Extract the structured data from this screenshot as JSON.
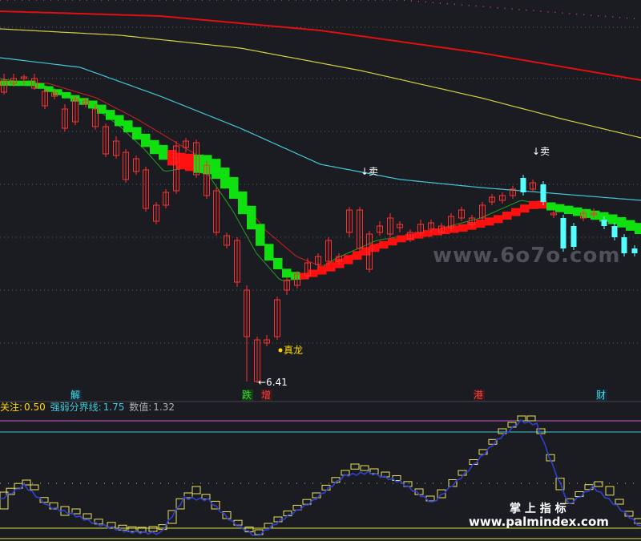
{
  "chart_data": {
    "type": "candlestick",
    "price_chart": {
      "price_marker_low": "←6.41",
      "buy_marker": "真龙",
      "sell_markers": [
        "↓卖",
        "↓卖"
      ],
      "date_tags": [
        {
          "text": "解",
          "color": "#40e0e0"
        },
        {
          "text": "跌",
          "color": "#30e030"
        },
        {
          "text": "增",
          "color": "#ff4040"
        },
        {
          "text": "港",
          "color": "#ff4040"
        },
        {
          "text": "财",
          "color": "#40e0e0"
        }
      ],
      "watermark": "www.6o7o.com"
    },
    "indicator": {
      "label_focus": "关注:",
      "value_focus": "0.50",
      "label_threshold": "强弱分界线:",
      "value_threshold": "1.75",
      "label_value": "数值:",
      "value_value": "1.32",
      "watermark_title": "掌 上 指 标",
      "watermark_url": "www.palmindex.com"
    },
    "colors": {
      "up": "#ff3030",
      "down": "#54ffff",
      "ribbon_up": "#ff1010",
      "ribbon_down": "#10e010",
      "ma_long": "#e01010",
      "ma_yellow": "#d8d040",
      "ma_cyan": "#40c8d8",
      "indicator_line": "#3040d0"
    }
  }
}
